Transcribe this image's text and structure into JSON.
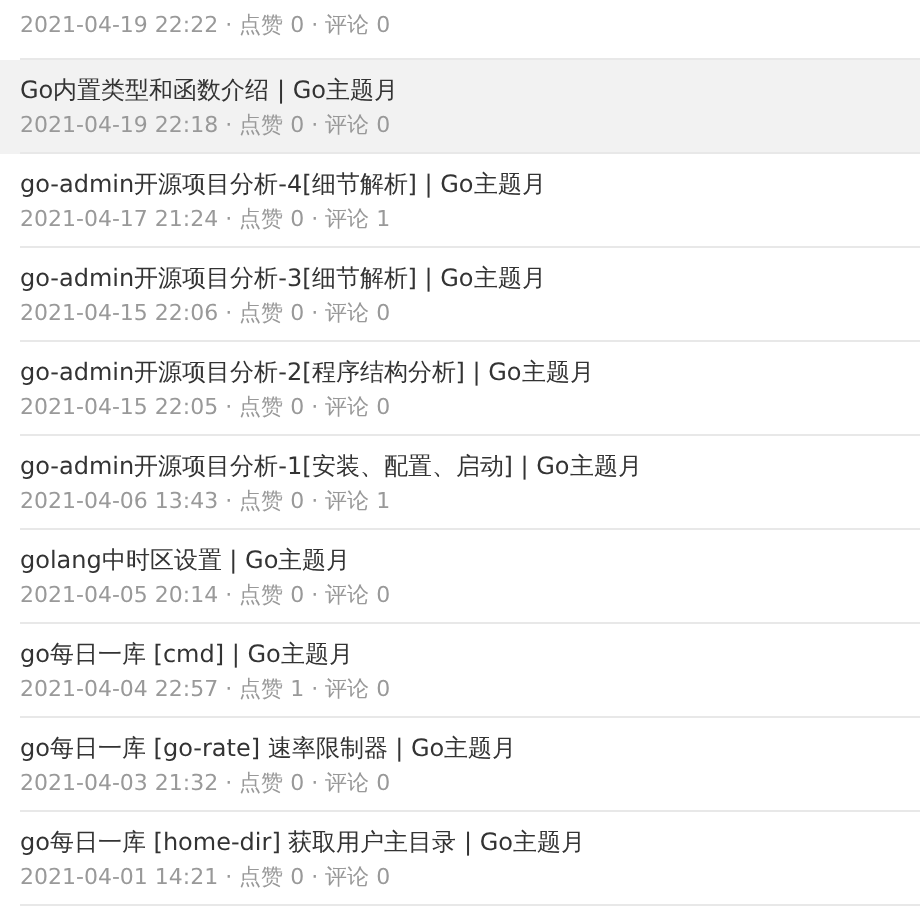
{
  "posts": [
    {
      "meta": "2021-04-19 22:22 · 点赞 0 · 评论 0",
      "highlighted": false
    },
    {
      "title": "Go内置类型和函数介绍 | Go主题月",
      "meta": "2021-04-19 22:18 · 点赞 0 · 评论 0",
      "highlighted": true
    },
    {
      "title": "go-admin开源项目分析-4[细节解析] | Go主题月",
      "meta": "2021-04-17 21:24 · 点赞 0 · 评论 1",
      "highlighted": false
    },
    {
      "title": "go-admin开源项目分析-3[细节解析] | Go主题月",
      "meta": "2021-04-15 22:06 · 点赞 0 · 评论 0",
      "highlighted": false
    },
    {
      "title": "go-admin开源项目分析-2[程序结构分析] | Go主题月",
      "meta": "2021-04-15 22:05 · 点赞 0 · 评论 0",
      "highlighted": false
    },
    {
      "title": "go-admin开源项目分析-1[安装、配置、启动] | Go主题月",
      "meta": "2021-04-06 13:43 · 点赞 0 · 评论 1",
      "highlighted": false
    },
    {
      "title": "golang中时区设置 | Go主题月",
      "meta": "2021-04-05 20:14 · 点赞 0 · 评论 0",
      "highlighted": false
    },
    {
      "title": "go每日一库 [cmd] | Go主题月",
      "meta": "2021-04-04 22:57 · 点赞 1 · 评论 0",
      "highlighted": false
    },
    {
      "title": "go每日一库 [go-rate] 速率限制器 | Go主题月",
      "meta": "2021-04-03 21:32 · 点赞 0 · 评论 0",
      "highlighted": false
    },
    {
      "title": "go每日一库 [home-dir] 获取用户主目录 | Go主题月",
      "meta": "2021-04-01 14:21 · 点赞 0 · 评论 0",
      "highlighted": false
    }
  ]
}
